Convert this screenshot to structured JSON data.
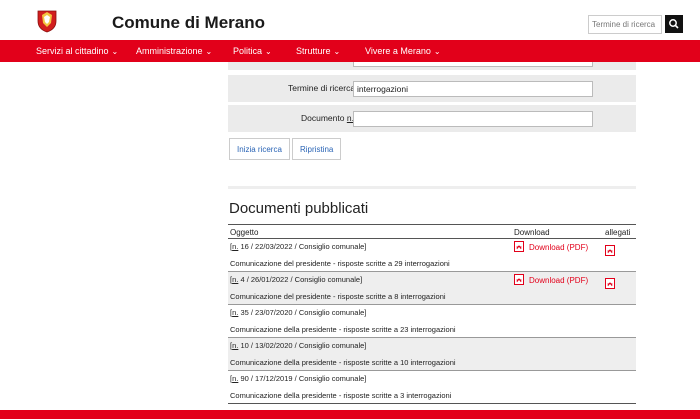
{
  "header": {
    "site_title": "Comune di Merano",
    "search_placeholder": "Termine di ricerca",
    "search_icon": "search-icon",
    "logo_icon": "coat-of-arms-icon"
  },
  "nav": {
    "items": [
      {
        "label": "Servizi al cittadino"
      },
      {
        "label": "Amministrazione"
      },
      {
        "label": "Politica"
      },
      {
        "label": "Strutture"
      },
      {
        "label": "Vivere a Merano"
      }
    ],
    "chevron": "⌄"
  },
  "search_form": {
    "term_label": "Termine di ricerca",
    "term_value": "interrogazioni",
    "doc_label_prefix": "Documento ",
    "doc_label_n": "n.",
    "doc_value": "",
    "start_button": "Inizia ricerca",
    "reset_button": "Ripristina"
  },
  "results": {
    "title": "Documenti pubblicati",
    "columns": {
      "subject": "Oggetto",
      "download": "Download",
      "attachments": "allegati"
    },
    "rows": [
      {
        "n": "n.",
        "meta": " 16 / 22/03/2022 / Consiglio comunale]",
        "desc": "Comunicazione del presidente - risposte scritte a 29 interrogazioni",
        "download": "Download (PDF)",
        "has_attachment": true
      },
      {
        "n": "n.",
        "meta": " 4 / 26/01/2022 / Consiglio comunale]",
        "desc": "Comunicazione del presidente - risposte scritte a 8 interrogazioni",
        "download": "Download (PDF)",
        "has_attachment": true
      },
      {
        "n": "n.",
        "meta": " 35 / 23/07/2020 / Consiglio comunale]",
        "desc": "Comunicazione della presidente - risposte scritte a 23 interrogazioni",
        "download": "",
        "has_attachment": false
      },
      {
        "n": "n.",
        "meta": " 10 / 13/02/2020 / Consiglio comunale]",
        "desc": "Comunicazione della presidente - risposte scritte a 10 interrogazioni",
        "download": "",
        "has_attachment": false
      },
      {
        "n": "n.",
        "meta": " 90 / 17/12/2019 / Consiglio comunale]",
        "desc": "Comunicazione della presidente - risposte scritte a 3 interrogazioni",
        "download": "",
        "has_attachment": false
      }
    ]
  },
  "colors": {
    "brand_red": "#e2001a",
    "link_blue": "#2a64b5"
  }
}
